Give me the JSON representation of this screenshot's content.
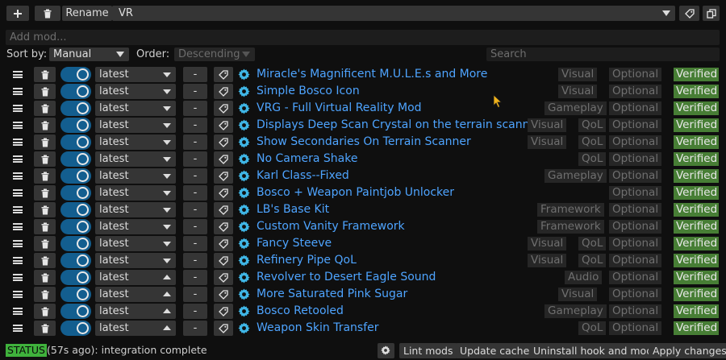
{
  "toolbar": {
    "rename_label": "Rename",
    "profile_value": "VR"
  },
  "add_mod": {
    "placeholder": "Add mod..."
  },
  "sort": {
    "sort_by_label": "Sort by:",
    "sort_by_value": "Manual",
    "order_label": "Order:",
    "order_value": "Descending",
    "search_placeholder": "Search"
  },
  "mods": [
    {
      "version": "latest",
      "arrow": "down",
      "name": "Miracle's Magnificent M.U.L.E.s and More",
      "tags": [
        "Visual",
        "Optional"
      ],
      "verified": "Verified"
    },
    {
      "version": "latest",
      "arrow": "down",
      "name": "Simple Bosco Icon",
      "tags": [
        "Visual",
        "Optional"
      ],
      "verified": "Verified"
    },
    {
      "version": "latest",
      "arrow": "down",
      "name": "VRG - Full Virtual Reality Mod",
      "tags": [
        "Gameplay",
        "Optional"
      ],
      "verified": "Verified"
    },
    {
      "version": "latest",
      "arrow": "down",
      "name": "Displays Deep Scan Crystal on the terrain scanner",
      "tags": [
        "Visual",
        "QoL",
        "Optional"
      ],
      "verified": "Verified"
    },
    {
      "version": "latest",
      "arrow": "down",
      "name": "Show Secondaries On Terrain Scanner",
      "tags": [
        "Visual",
        "QoL",
        "Optional"
      ],
      "verified": "Verified"
    },
    {
      "version": "latest",
      "arrow": "down",
      "name": "No Camera Shake",
      "tags": [
        "QoL",
        "Optional"
      ],
      "verified": "Verified"
    },
    {
      "version": "latest",
      "arrow": "down",
      "name": "Karl Class--Fixed",
      "tags": [
        "Gameplay",
        "Optional"
      ],
      "verified": "Verified"
    },
    {
      "version": "latest",
      "arrow": "down",
      "name": "Bosco + Weapon Paintjob Unlocker",
      "tags": [
        "Optional"
      ],
      "verified": "Verified"
    },
    {
      "version": "latest",
      "arrow": "down",
      "name": "LB's Base Kit",
      "tags": [
        "Framework",
        "Optional"
      ],
      "verified": "Verified"
    },
    {
      "version": "latest",
      "arrow": "down",
      "name": "Custom Vanity Framework",
      "tags": [
        "Framework",
        "Optional"
      ],
      "verified": "Verified"
    },
    {
      "version": "latest",
      "arrow": "down",
      "name": "Fancy Steeve",
      "tags": [
        "Visual",
        "QoL",
        "Optional"
      ],
      "verified": "Verified"
    },
    {
      "version": "latest",
      "arrow": "down",
      "name": "Refinery Pipe QoL",
      "tags": [
        "Visual",
        "QoL",
        "Optional"
      ],
      "verified": "Verified"
    },
    {
      "version": "latest",
      "arrow": "up",
      "name": "Revolver to Desert Eagle Sound",
      "tags": [
        "Audio",
        "Optional"
      ],
      "verified": "Verified"
    },
    {
      "version": "latest",
      "arrow": "up",
      "name": "More Saturated Pink Sugar",
      "tags": [
        "Visual",
        "Optional"
      ],
      "verified": "Verified"
    },
    {
      "version": "latest",
      "arrow": "up",
      "name": "Bosco Retooled",
      "tags": [
        "Gameplay",
        "Optional"
      ],
      "verified": "Verified"
    },
    {
      "version": "latest",
      "arrow": "up",
      "name": "Weapon Skin Transfer",
      "tags": [
        "QoL",
        "Optional"
      ],
      "verified": "Verified"
    }
  ],
  "dash_label": "-",
  "status": {
    "label": "STATUS",
    "text": "(57s ago): integration complete",
    "buttons": {
      "lint": "Lint mods",
      "update_cache": "Update cache",
      "uninstall": "Uninstall hook and mods",
      "apply": "Apply changes"
    }
  },
  "colors": {
    "accent_blue": "#4ea4ff",
    "toggle_on": "#135e8f",
    "verified_green": "#477e35",
    "status_green": "#3fb23c",
    "gear_cyan": "#3fb6e6"
  }
}
